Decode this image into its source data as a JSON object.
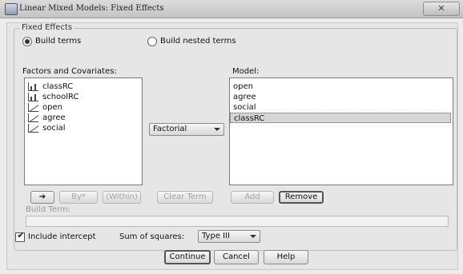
{
  "window": {
    "title": "Linear Mixed Models: Fixed Effects",
    "close_glyph": "✕"
  },
  "fixed_effects": {
    "group_title": "Fixed Effects",
    "build_terms_label": "Build terms",
    "build_nested_label": "Build nested terms",
    "build_terms_selected": true
  },
  "factors": {
    "label": "Factors and Covariates:",
    "items": [
      {
        "label": "classRC",
        "icon": "nominal-icon"
      },
      {
        "label": "schoolRC",
        "icon": "nominal-icon"
      },
      {
        "label": "open",
        "icon": "scale-icon"
      },
      {
        "label": "agree",
        "icon": "scale-icon"
      },
      {
        "label": "social",
        "icon": "scale-icon"
      }
    ]
  },
  "model": {
    "label": "Model:",
    "items": [
      "open",
      "agree",
      "social",
      "classRC"
    ],
    "selected_index": 3
  },
  "term_type": {
    "selected": "Factorial"
  },
  "buttons": {
    "move_arrow": "➔",
    "by": "By*",
    "within": "(Within)",
    "clear_term": "Clear Term",
    "add": "Add",
    "remove": "Remove"
  },
  "build_term": {
    "label": "Build Term:",
    "value": ""
  },
  "include_intercept": {
    "label": "Include intercept",
    "checked": true
  },
  "sum_of_squares": {
    "label": "Sum of squares:",
    "selected": "Type III"
  },
  "dialog_buttons": {
    "continue": "Continue",
    "cancel": "Cancel",
    "help": "Help"
  }
}
